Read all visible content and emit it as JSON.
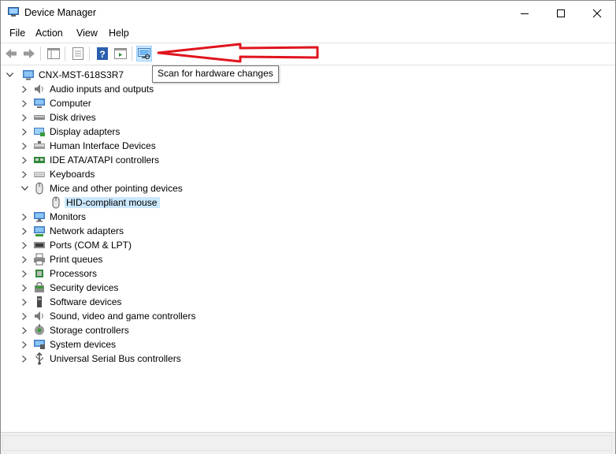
{
  "window": {
    "title": "Device Manager"
  },
  "menu": {
    "file": "File",
    "action": "Action",
    "view": "View",
    "help": "Help"
  },
  "toolbar": {
    "tooltip": "Scan for hardware changes"
  },
  "tree": {
    "root": "CNX-MST-618S3R7",
    "categories": [
      {
        "label": "Audio inputs and outputs",
        "icon": "speaker-icon"
      },
      {
        "label": "Computer",
        "icon": "computer-icon"
      },
      {
        "label": "Disk drives",
        "icon": "disk-drive-icon"
      },
      {
        "label": "Display adapters",
        "icon": "display-adapter-icon"
      },
      {
        "label": "Human Interface Devices",
        "icon": "hid-icon"
      },
      {
        "label": "IDE ATA/ATAPI controllers",
        "icon": "ide-controller-icon"
      },
      {
        "label": "Keyboards",
        "icon": "keyboard-icon"
      },
      {
        "label": "Mice and other pointing devices",
        "icon": "mouse-icon"
      },
      {
        "label": "Monitors",
        "icon": "monitor-icon"
      },
      {
        "label": "Network adapters",
        "icon": "network-adapter-icon"
      },
      {
        "label": "Ports (COM & LPT)",
        "icon": "port-icon"
      },
      {
        "label": "Print queues",
        "icon": "printer-icon"
      },
      {
        "label": "Processors",
        "icon": "processor-icon"
      },
      {
        "label": "Security devices",
        "icon": "security-device-icon"
      },
      {
        "label": "Software devices",
        "icon": "software-device-icon"
      },
      {
        "label": "Sound, video and game controllers",
        "icon": "sound-controller-icon"
      },
      {
        "label": "Storage controllers",
        "icon": "storage-controller-icon"
      },
      {
        "label": "System devices",
        "icon": "system-device-icon"
      },
      {
        "label": "Universal Serial Bus controllers",
        "icon": "usb-icon"
      }
    ],
    "expanded_child": {
      "label": "HID-compliant mouse",
      "icon": "mouse-icon"
    }
  },
  "colors": {
    "selection": "#cce8ff",
    "arrow": "#e0141e",
    "accent": "#0078d7"
  }
}
